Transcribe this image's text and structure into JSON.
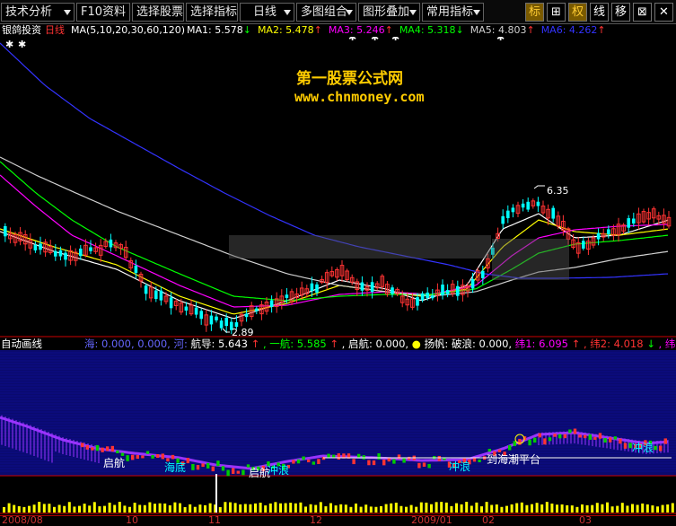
{
  "toolbar": {
    "buttons": [
      {
        "label": "技术分析",
        "arrow": true
      },
      {
        "label": "F10资料",
        "arrow": false
      },
      {
        "label": "选择股票",
        "arrow": false
      },
      {
        "label": "选择指标",
        "arrow": false
      },
      {
        "label": "日线",
        "arrow": true
      },
      {
        "label": "多图组合",
        "arrow": true
      },
      {
        "label": "图形叠加",
        "arrow": true
      },
      {
        "label": "常用指标",
        "arrow": true
      }
    ],
    "icons": [
      {
        "label": "标",
        "name": "mark-button",
        "selected": true
      },
      {
        "label": "⊞",
        "name": "crosshair-button",
        "selected": false
      },
      {
        "label": "权",
        "name": "rights-button",
        "selected": true
      },
      {
        "label": "线",
        "name": "line-button",
        "selected": false
      },
      {
        "label": "移",
        "name": "move-button",
        "selected": false
      },
      {
        "label": "⊠",
        "name": "window-button",
        "selected": false
      },
      {
        "label": "✕",
        "name": "close-button",
        "selected": false
      }
    ]
  },
  "stock": {
    "name": "银鸽投资",
    "period": "日线",
    "ma_params": "MA(5,10,20,30,60,120)"
  },
  "ma_values": [
    {
      "label": "MA1:",
      "value": "5.578",
      "arrow": "↓",
      "color": "#ffffff"
    },
    {
      "label": "MA2:",
      "value": "5.478",
      "arrow": "↑",
      "color": "#ffff00"
    },
    {
      "label": "MA3:",
      "value": "5.246",
      "arrow": "↑",
      "color": "#ff00ff"
    },
    {
      "label": "MA4:",
      "value": "5.318",
      "arrow": "↓",
      "color": "#00ff00"
    },
    {
      "label": "MA5:",
      "value": "4.803",
      "arrow": "↑",
      "color": "#d0d0d0"
    },
    {
      "label": "MA6:",
      "value": "4.262",
      "arrow": "↑",
      "color": "#3333ff"
    }
  ],
  "watermark": {
    "line1": "第一股票公式网",
    "line2": "www.chnmoney.com"
  },
  "annotations": {
    "high": "6.35",
    "low": "2.89"
  },
  "indicator": {
    "name": "自动画线",
    "items": [
      {
        "text": "海: 0.000, 0.000, 河:",
        "color": "#6666ff"
      },
      {
        "text": "航导: 5.643",
        "color": "#ffffff"
      },
      {
        "text": "↑",
        "color": "#ff3333"
      },
      {
        "text": ", 一航: 5.585",
        "color": "#00ff00"
      },
      {
        "text": "↑",
        "color": "#ff3333"
      },
      {
        "text": ", 启航: 0.000,",
        "color": "#ffffff"
      },
      {
        "text": "●",
        "color": "#ffff00"
      },
      {
        "text": "扬帆: 破浪: 0.000,",
        "color": "#ffffff"
      },
      {
        "text": "纬1: 6.095",
        "color": "#ff00ff"
      },
      {
        "text": "↑",
        "color": "#ff3333"
      },
      {
        "text": ", 纬2: 4.018",
        "color": "#ff3333"
      },
      {
        "text": "↓",
        "color": "#00ff00"
      },
      {
        "text": ", 纬",
        "color": "#ff00ff"
      }
    ],
    "labels": [
      "启航",
      "海底",
      "启航",
      "冲浪",
      "冲浪",
      "到海潮平台",
      "冲浪"
    ]
  },
  "dates": [
    "2008/08",
    "10",
    "11",
    "12",
    "2009/01",
    "02",
    "03"
  ],
  "colors": {
    "up": "#ff3333",
    "down": "#00ffff",
    "ma1": "#ffffff",
    "ma2": "#ffff00",
    "ma3": "#ff00ff",
    "ma4": "#00ff00",
    "ma5": "#d0d0d0",
    "ma6": "#3333ff",
    "indicator_bg": "#0a0a6e",
    "volume": "#ffff00",
    "grid": "#cc0000"
  }
}
